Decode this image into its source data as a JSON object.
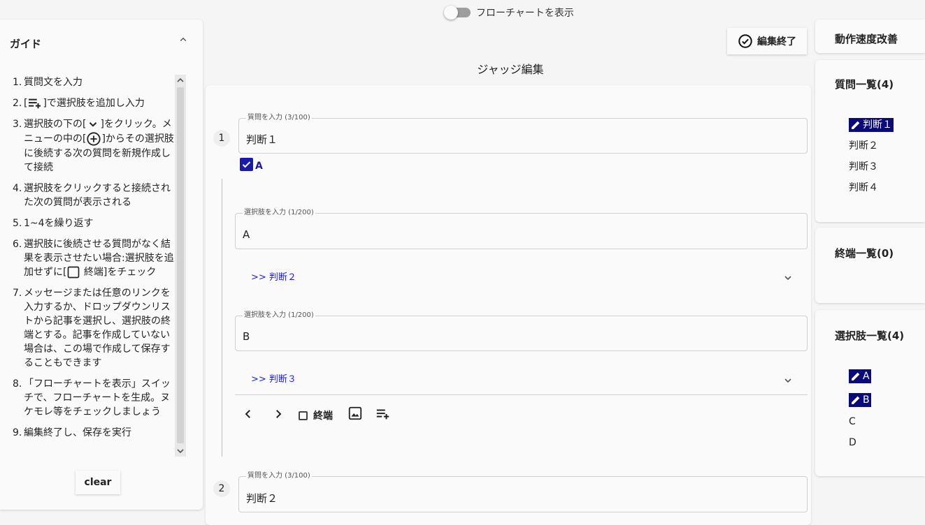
{
  "toggle": {
    "label": "フローチャートを表示",
    "on": false
  },
  "guide": {
    "title": "ガイド",
    "items": [
      {
        "num": "1.",
        "text": "質問文を入力"
      },
      {
        "num": "2.",
        "pre": "[",
        "post": "]で選択肢を追加し入力"
      },
      {
        "num": "3.",
        "pre": "選択肢の下の[",
        "mid": "]をクリック。メニューの中の[",
        "post": "]からその選択肢に後続する次の質問を新規作成して接続"
      },
      {
        "num": "4.",
        "text": "選択肢をクリックすると接続された次の質問が表示される"
      },
      {
        "num": "5.",
        "text": "1~4を繰り返す"
      },
      {
        "num": "6.",
        "pre": "選択肢に後続させる質問がなく結果を表示させたい場合:選択肢を追加せずに[",
        "post": " 終端]をチェック"
      },
      {
        "num": "7.",
        "text": "メッセージまたは任意のリンクを入力するか、ドロップダウンリストから記事を選択し、選択肢の終端とする。記事を作成していない場合は、この場で作成して保存することもできます"
      },
      {
        "num": "8.",
        "text": "「フローチャートを表示」スイッチで、フローチャートを生成。ヌケモレ等をチェックしましょう"
      },
      {
        "num": "9.",
        "text": "編集終了し、保存を実行"
      }
    ],
    "clear_label": "clear"
  },
  "header": {
    "finish_label": "編集終了",
    "page_title": "ジャッジ編集"
  },
  "editor": {
    "q1": {
      "num": "1",
      "label": "質問を入力 (3/100)",
      "value": "判断１",
      "checked_choice": "A"
    },
    "choices": [
      {
        "label": "選択肢を入力 (1/200)",
        "value": "A",
        "next": ">> 判断２"
      },
      {
        "label": "選択肢を入力 (1/200)",
        "value": "B",
        "next": ">> 判断３"
      }
    ],
    "toolbar": {
      "terminal_label": "終端"
    },
    "q2": {
      "num": "2",
      "label": "質問を入力 (3/100)",
      "value": "判断２"
    }
  },
  "right": {
    "speed": {
      "title": "動作速度改善"
    },
    "questions": {
      "title": "質問一覧(4)",
      "items": [
        "判断１",
        "判断２",
        "判断３",
        "判断４"
      ]
    },
    "terminals": {
      "title": "終端一覧(0)"
    },
    "choices": {
      "title": "選択肢一覧(4)",
      "items": [
        "A",
        "B",
        "C",
        "D"
      ]
    }
  },
  "colors": {
    "accent": "#1a1aff",
    "highlight": "#0a0a7a",
    "checkbox": "#1a1aa8"
  }
}
